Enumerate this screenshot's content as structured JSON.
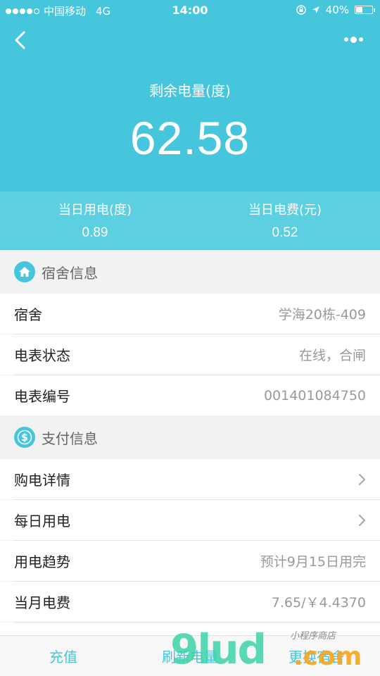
{
  "status_bar": {
    "carrier": "中国移动",
    "network": "4G",
    "time": "14:00",
    "battery": "40%",
    "battery_level": 0.4
  },
  "header": {
    "remain_label": "剩余电量(度)",
    "remain_value": "62.58"
  },
  "daily": {
    "usage_label": "当日用电(度)",
    "usage_value": "0.89",
    "fee_label": "当日电费(元)",
    "fee_value": "0.52"
  },
  "dorm_section": {
    "title": "宿舍信息",
    "icon": "house-icon",
    "rows": [
      {
        "key": "宿舍",
        "value": "学海20栋-409"
      },
      {
        "key": "电表状态",
        "value": "在线，合闸"
      },
      {
        "key": "电表编号",
        "value": "001401084750"
      }
    ]
  },
  "pay_section": {
    "title": "支付信息",
    "icon": "dollar-icon",
    "rows": [
      {
        "key": "购电详情",
        "value": ""
      },
      {
        "key": "每日用电",
        "value": ""
      },
      {
        "key": "用电趋势",
        "value": "预计9月15日用完"
      },
      {
        "key": "当月电费",
        "value": "7.65/￥4.4370"
      }
    ]
  },
  "bottom_bar": {
    "recharge": "充值",
    "refresh": "刷新电量",
    "change_dorm": "更换宿舍"
  },
  "watermark": {
    "brand": "9lud",
    "suffix": ".com",
    "tagline": "小程序商店"
  },
  "colors": {
    "accent": "#46c6dd",
    "accent_light": "#5ccfe0"
  }
}
